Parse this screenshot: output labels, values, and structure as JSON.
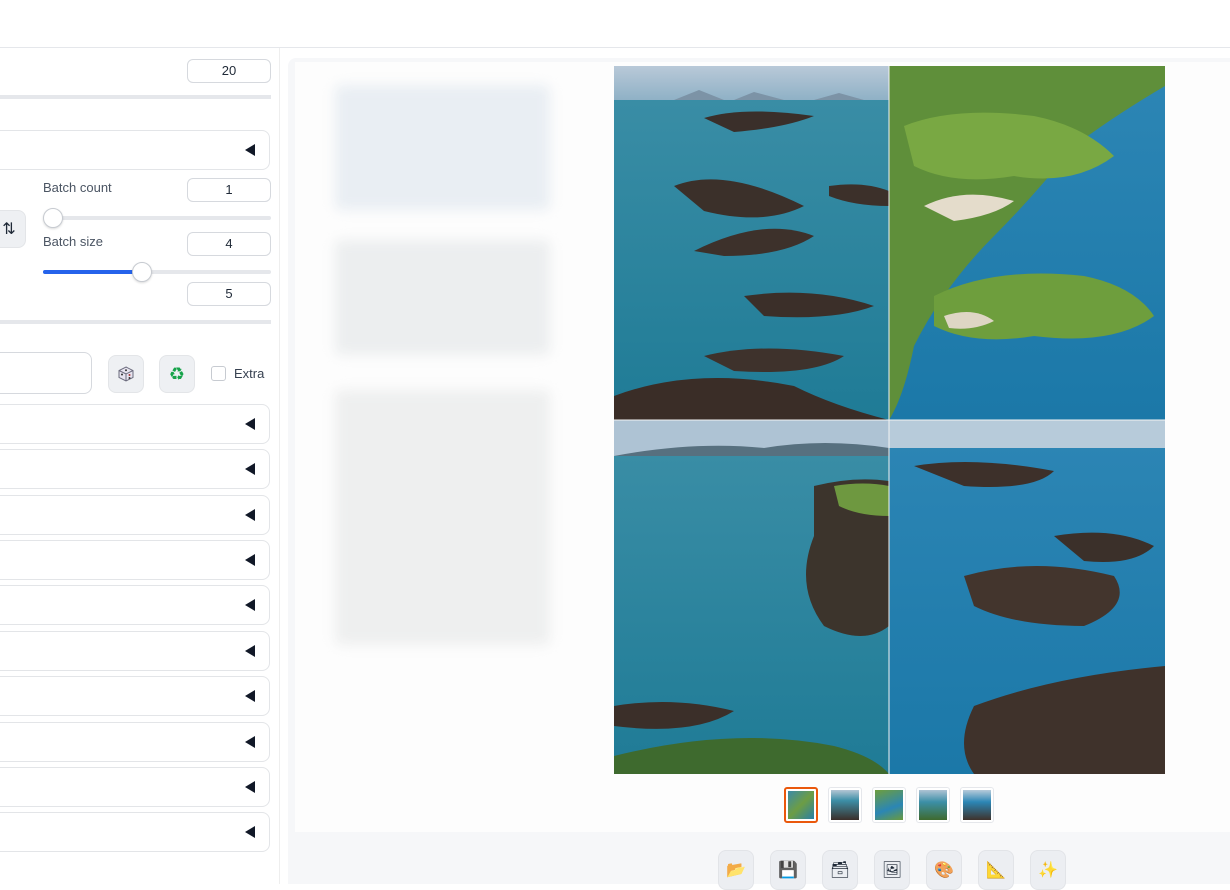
{
  "steps": {
    "value": "20"
  },
  "batch_count": {
    "label": "Batch count",
    "value": "1",
    "fraction": 0.0
  },
  "batch_size": {
    "label": "Batch size",
    "value": "4",
    "fraction": 0.43
  },
  "cfg": {
    "value": "5"
  },
  "seed": {
    "value": "",
    "extra_label": "Extra"
  },
  "icons": {
    "swap": "swap-dimensions-icon",
    "dice": "dice-icon",
    "recycle": "recycle-icon",
    "expand": "triangle-left-icon"
  },
  "accordions_count": 10,
  "thumbnails": [
    "thumbnail-1",
    "thumbnail-2",
    "thumbnail-3",
    "thumbnail-4",
    "thumbnail-5"
  ],
  "toolbar": [
    "open-folder-icon",
    "save-icon",
    "zip-icon",
    "send-to-img2img-icon",
    "send-to-inpaint-icon",
    "send-to-extras-icon",
    "sparkles-icon"
  ],
  "colors": {
    "accent": "#2563eb",
    "selected_border": "#ea580c"
  }
}
